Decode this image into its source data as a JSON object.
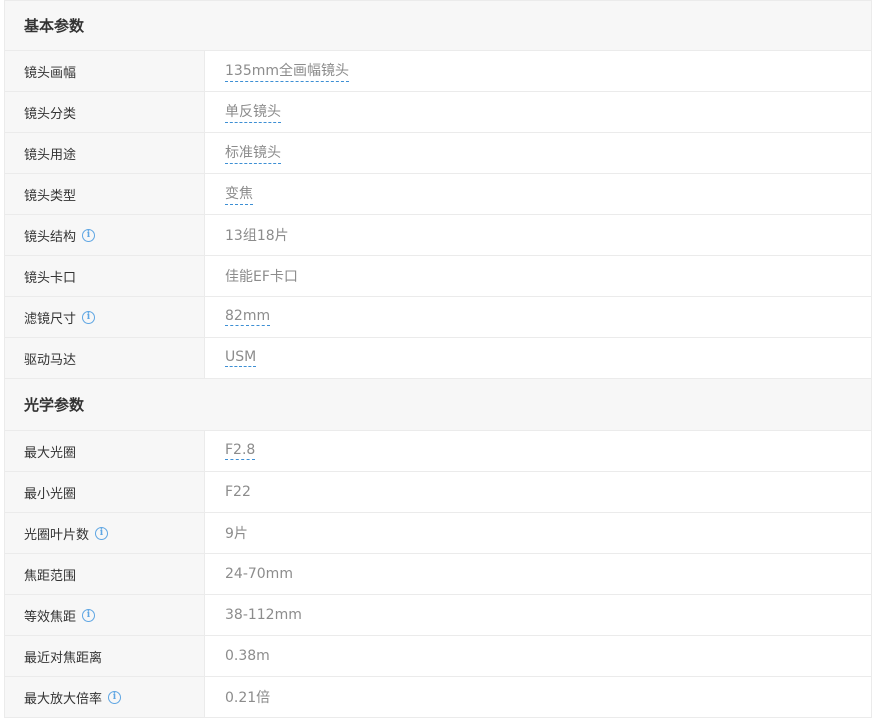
{
  "sections": [
    {
      "title": "基本参数",
      "rows": [
        {
          "label": "镜头画幅",
          "value": "135mm全画幅镜头",
          "link": true,
          "info": false
        },
        {
          "label": "镜头分类",
          "value": "单反镜头",
          "link": true,
          "info": false
        },
        {
          "label": "镜头用途",
          "value": "标准镜头",
          "link": true,
          "info": false
        },
        {
          "label": "镜头类型",
          "value": "变焦",
          "link": true,
          "info": false
        },
        {
          "label": "镜头结构",
          "value": "13组18片",
          "link": false,
          "info": true
        },
        {
          "label": "镜头卡口",
          "value": "佳能EF卡口",
          "link": false,
          "info": false
        },
        {
          "label": "滤镜尺寸",
          "value": "82mm",
          "link": true,
          "info": true
        },
        {
          "label": "驱动马达",
          "value": "USM",
          "link": true,
          "info": false
        }
      ]
    },
    {
      "title": "光学参数",
      "rows": [
        {
          "label": "最大光圈",
          "value": "F2.8",
          "link": true,
          "info": false
        },
        {
          "label": "最小光圈",
          "value": "F22",
          "link": false,
          "info": false
        },
        {
          "label": "光圈叶片数",
          "value": "9片",
          "link": false,
          "info": true
        },
        {
          "label": "焦距范围",
          "value": "24-70mm",
          "link": false,
          "info": false
        },
        {
          "label": "等效焦距",
          "value": "38-112mm",
          "link": false,
          "info": true
        },
        {
          "label": "最近对焦距离",
          "value": "0.38m",
          "link": false,
          "info": false
        },
        {
          "label": "最大放大倍率",
          "value": "0.21倍",
          "link": false,
          "info": true
        }
      ]
    }
  ],
  "info_icon_glyph": "i",
  "colors": {
    "link_underline": "#3d8fd4",
    "info_icon": "#5fa6e3",
    "label_bg": "#f7f7f7",
    "value_text": "#8c8c8c"
  }
}
